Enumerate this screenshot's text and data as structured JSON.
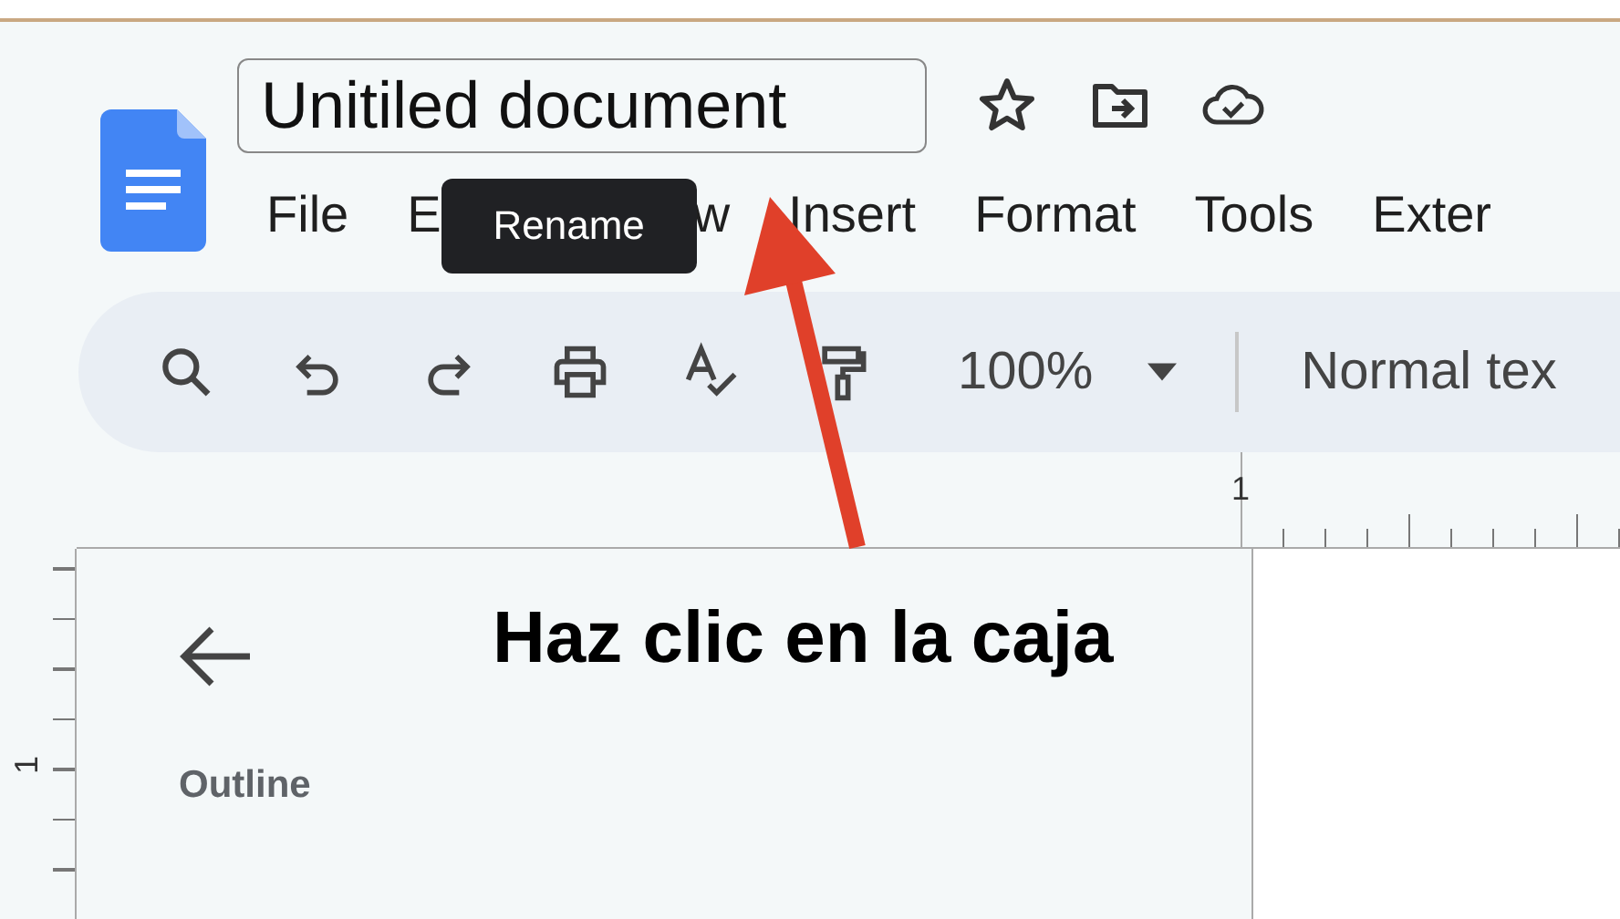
{
  "doc_title": {
    "value": "Unitiled document"
  },
  "menu": [
    "File",
    "E",
    "w",
    "Insert",
    "Format",
    "Tools",
    "Exter"
  ],
  "tooltip": "Rename",
  "toolbar": {
    "zoom": "100%",
    "style": "Normal tex"
  },
  "ruler": {
    "horizontal_label": "1",
    "vertical_label": "1"
  },
  "outline_panel": {
    "title": "Outline"
  },
  "annotation": {
    "caption": "Haz clic en la caja"
  }
}
